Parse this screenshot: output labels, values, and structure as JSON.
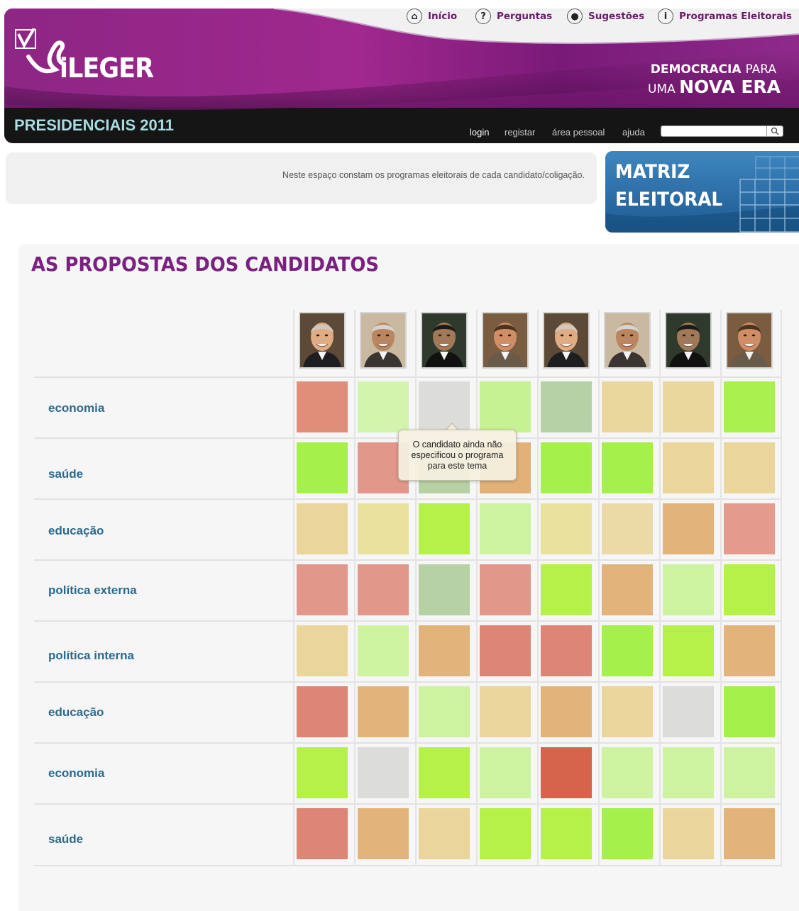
{
  "nav": {
    "items": [
      {
        "label": "Início",
        "icon": "home-icon",
        "glyph": "⌂"
      },
      {
        "label": "Perguntas",
        "icon": "question-icon",
        "glyph": "?"
      },
      {
        "label": "Sugestões",
        "icon": "lightbulb-icon",
        "glyph": "●"
      },
      {
        "label": "Programas Eleitorais",
        "icon": "info-icon",
        "glyph": "i"
      }
    ]
  },
  "header": {
    "logo_text": "ViLEGER",
    "logo_text_rest": "iLEGER",
    "tagline_line1_bold": "DEMOCRACIA",
    "tagline_line1_thin": "PARA",
    "tagline_line2_thin": "UMA",
    "tagline_line2_bold": "NOVA ERA",
    "section_title": "PRESIDENCIAIS 2011",
    "user_links": [
      "login",
      "registar",
      "área pessoal",
      "ajuda"
    ],
    "search_placeholder": ""
  },
  "info": {
    "text": "Neste espaço constam os programas eleitorais de cada candidato/coligação.",
    "badge_line1": "MATRIZ",
    "badge_line2": "ELEITORAL"
  },
  "colors": {
    "brand_purple": "#8a1f86",
    "accent_blue": "#2b6a8e",
    "title_purple": "#7a2180"
  },
  "matrix": {
    "title": "AS PROPOSTAS DOS CANDIDATOS",
    "candidates": [
      {
        "photo": "candidate-photo-1"
      },
      {
        "photo": "candidate-photo-2"
      },
      {
        "photo": "candidate-photo-3"
      },
      {
        "photo": "candidate-photo-4"
      },
      {
        "photo": "candidate-photo-1"
      },
      {
        "photo": "candidate-photo-2"
      },
      {
        "photo": "candidate-photo-3"
      },
      {
        "photo": "candidate-photo-4"
      }
    ],
    "rows": [
      {
        "topic": "economia",
        "cells": [
          "#e08e79",
          "#d2f4ad",
          "#dcdcda",
          "#c7f293",
          "#b6d1a3",
          "#ead79d",
          "#ead79d",
          "#a8f14f"
        ]
      },
      {
        "topic": "saúde",
        "cells": [
          "#a5f04a",
          "#e1978a",
          "#b6d1a3",
          "#e2b178",
          "#a5f04a",
          "#a5f04a",
          "#ead59b",
          "#ead59b"
        ]
      },
      {
        "topic": "educação",
        "cells": [
          "#ead59b",
          "#ebe19e",
          "#b6f149",
          "#cdf3a0",
          "#ebe19e",
          "#ebd9a6",
          "#e2b47c",
          "#e29b8c"
        ]
      },
      {
        "topic": "política externa",
        "cells": [
          "#e1978a",
          "#e1978a",
          "#b6d1a3",
          "#e1978a",
          "#b6f149",
          "#e2b47c",
          "#cdf3a0",
          "#b6f149"
        ]
      },
      {
        "topic": "política interna",
        "cells": [
          "#ead59b",
          "#cdf3a0",
          "#e2b47c",
          "#dd8675",
          "#dd8675",
          "#a5f04a",
          "#b6f149",
          "#e2b47c"
        ]
      },
      {
        "topic": "educação",
        "cells": [
          "#dd8675",
          "#e2b47c",
          "#cdf3a0",
          "#ead59b",
          "#e2b47c",
          "#ead59b",
          "#dcdcda",
          "#a5f04a"
        ]
      },
      {
        "topic": "economia",
        "cells": [
          "#b6f149",
          "#dcdcda",
          "#b6f149",
          "#cdf3a0",
          "#d6644d",
          "#cdf3a0",
          "#cdf3a0",
          "#cdf3a0"
        ]
      },
      {
        "topic": "saúde",
        "cells": [
          "#dd8675",
          "#e2b47c",
          "#ead59b",
          "#b6f149",
          "#b6f149",
          "#a5f04a",
          "#ead59b",
          "#e2b47c"
        ]
      }
    ],
    "tooltip": {
      "line1": "O candidato ainda não",
      "line2": "especificou o programa",
      "line3": "para este tema"
    }
  }
}
